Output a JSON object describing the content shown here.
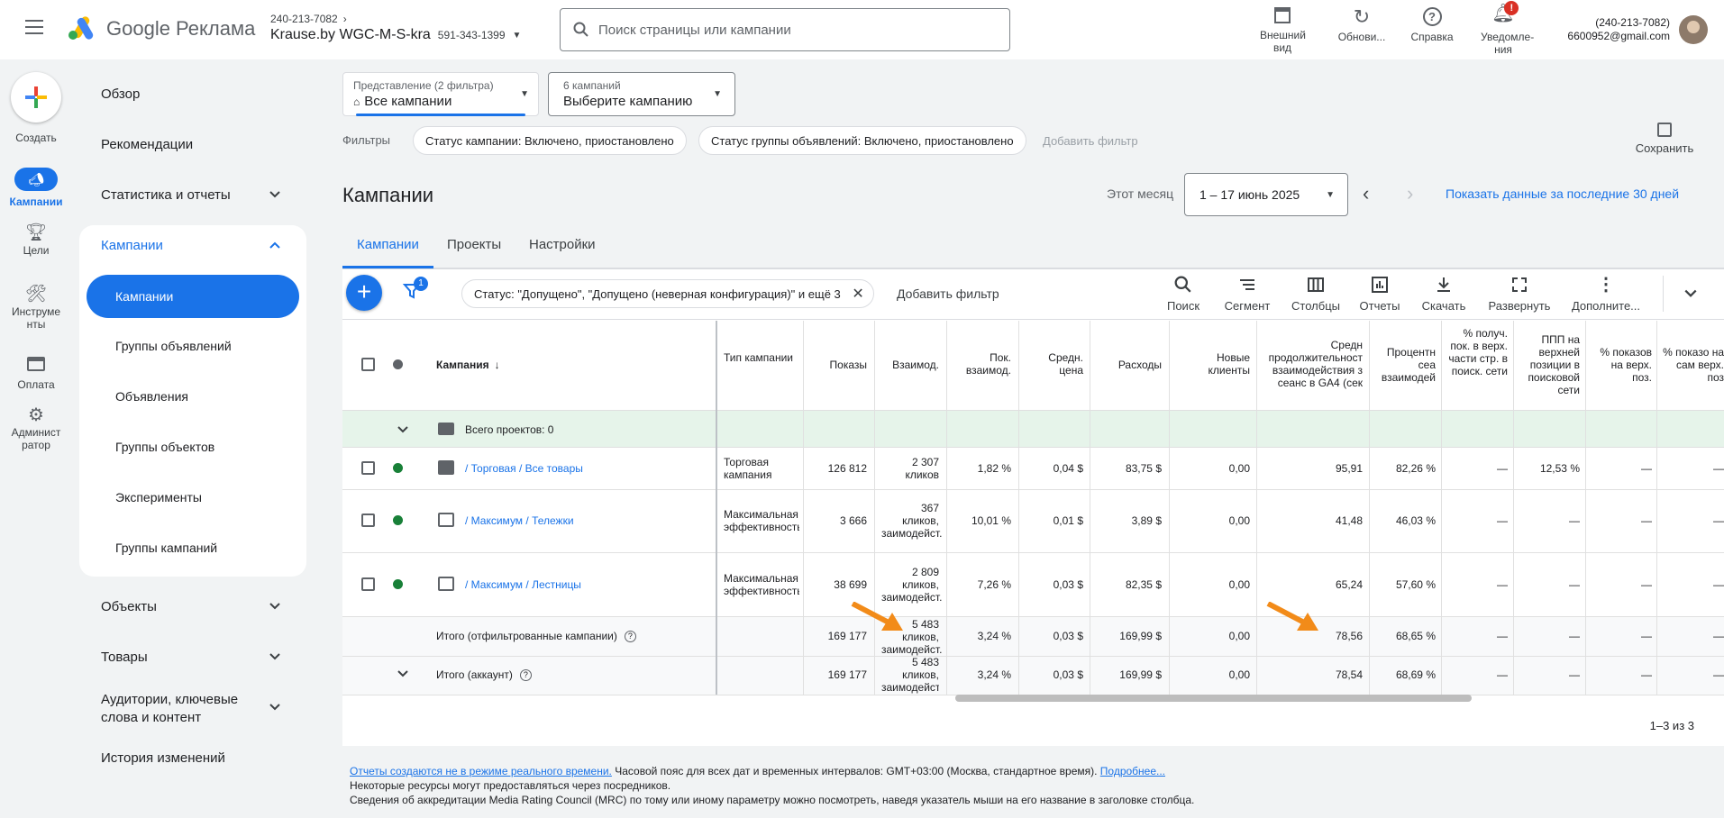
{
  "topbar": {
    "product": "Google Реклама",
    "account_id_top": "240-213-7082",
    "account_name": "Krause.by WGC-M-S-kra",
    "account_id": "591-343-1399",
    "search_placeholder": "Поиск страницы или кампании",
    "actions": [
      {
        "label": "Внешний вид",
        "icon": "appearance-icon"
      },
      {
        "label": "Обнови...",
        "icon": "refresh-icon"
      },
      {
        "label": "Справка",
        "icon": "help-icon"
      },
      {
        "label": "Уведомле-ния",
        "icon": "bell-icon",
        "badge": "!"
      }
    ],
    "user_phone": "(240-213-7082)",
    "user_email": "6600952@gmail.com"
  },
  "rail": {
    "create": "Создать",
    "items": [
      {
        "label": "Кампании",
        "icon": "campaign-icon",
        "active": true
      },
      {
        "label": "Цели",
        "icon": "trophy-icon"
      },
      {
        "label": "Инструме нты",
        "icon": "tools-icon"
      },
      {
        "label": "Оплата",
        "icon": "card-icon"
      },
      {
        "label": "Админист ратор",
        "icon": "gear-icon"
      }
    ]
  },
  "nav": {
    "overview": "Обзор",
    "recommendations": "Рекомендации",
    "stats": "Статистика и отчеты",
    "campaigns": "Кампании",
    "sub": [
      "Кампании",
      "Группы объявлений",
      "Объявления",
      "Группы объектов",
      "Эксперименты",
      "Группы кампаний"
    ],
    "objects": "Объекты",
    "products": "Товары",
    "audiences": "Аудитории, ключевые слова и контент",
    "history": "История изменений"
  },
  "view": {
    "view_label": "Представление (2 фильтра)",
    "view_value": "Все кампании",
    "campaign_label": "6 кампаний",
    "campaign_value": "Выберите кампанию"
  },
  "filters": {
    "label": "Фильтры",
    "chips": [
      "Статус кампании: Включено, приостановлено",
      "Статус группы объявлений: Включено, приостановлено"
    ],
    "add": "Добавить фильтр",
    "save": "Сохранить"
  },
  "page": {
    "title": "Кампании",
    "period_label": "Этот месяц",
    "date_range": "1 – 17 июнь 2025",
    "last30": "Показать данные за последние 30 дней",
    "tabs": [
      "Кампании",
      "Проекты",
      "Настройки"
    ]
  },
  "toolbar": {
    "filter_badge": "1",
    "status_chip": "Статус: \"Допущено\", \"Допущено (неверная конфигурация)\" и ещё 3",
    "add_filter": "Добавить фильтр",
    "tools": [
      "Поиск",
      "Сегмент",
      "Столбцы",
      "Отчеты",
      "Скачать",
      "Развернуть",
      "Дополните..."
    ]
  },
  "table": {
    "headers": {
      "campaign": "Кампания",
      "type": "Тип кампании",
      "impr": "Показы",
      "interactions": "Взаимод.",
      "ir": "Пок. взаимод.",
      "avg": "Средн. цена",
      "cost": "Расходы",
      "new_clients": "Новые клиенты",
      "duration": "Средн продолжительност взаимодействия з сеанс в GA4 (сек",
      "percent": "Процентн сеа взаимодей",
      "top_share": "% получ. пок. в верх. части стр. в поиск. сети",
      "ppp": "ППП на верхней позиции в поисковой сети",
      "top_pct": "% показов на верх. поз.",
      "abs_top": "% показо на сам верх. поз"
    },
    "projects_row": "Всего проектов: 0",
    "rows": [
      {
        "icon": "shopping-tag-icon",
        "name": "/ Торговая / Все товары",
        "type": "Торговая кампания",
        "impr": "126 812",
        "inter": "2 307 кликов",
        "ir": "1,82 %",
        "avg": "0,04 $",
        "cost": "83,75 $",
        "nc": "0,00",
        "dur": "95,91",
        "pct": "82,26 %",
        "ts": "—",
        "ppp": "12,53 %",
        "tp": "—",
        "at": "—"
      },
      {
        "icon": "pmax-icon",
        "name": "/ Максимум / Тележки",
        "type": "Максимальная эффективность",
        "impr": "3 666",
        "inter": "367 кликов, заимодейст.",
        "ir": "10,01 %",
        "avg": "0,01 $",
        "cost": "3,89 $",
        "nc": "0,00",
        "dur": "41,48",
        "pct": "46,03 %",
        "ts": "—",
        "ppp": "—",
        "tp": "—",
        "at": "—"
      },
      {
        "icon": "pmax-icon",
        "name": "/ Максимум / Лестницы",
        "type": "Максимальная эффективность",
        "impr": "38 699",
        "inter": "2 809 кликов, заимодейст.",
        "ir": "7,26 %",
        "avg": "0,03 $",
        "cost": "82,35 $",
        "nc": "0,00",
        "dur": "65,24",
        "pct": "57,60 %",
        "ts": "—",
        "ppp": "—",
        "tp": "—",
        "at": "—"
      }
    ],
    "totals": [
      {
        "name": "Итого (отфильтрованные кампании)",
        "impr": "169 177",
        "inter": "5 483 кликов, заимодейст.",
        "ir": "3,24 %",
        "avg": "0,03 $",
        "cost": "169,99 $",
        "nc": "0,00",
        "dur": "78,56",
        "pct": "68,65 %",
        "ts": "—",
        "ppp": "—",
        "tp": "—",
        "at": "—"
      },
      {
        "name": "Итого (аккаунт)",
        "impr": "169 177",
        "inter": "5 483 кликов, заимодейст.",
        "ir": "3,24 %",
        "avg": "0,03 $",
        "cost": "169,99 $",
        "nc": "0,00",
        "dur": "78,54",
        "pct": "68,69 %",
        "ts": "—",
        "ppp": "—",
        "tp": "—",
        "at": "—"
      }
    ],
    "pagination": "1–3 из 3"
  },
  "footer": {
    "link1": "Отчеты создаются не в режиме реального времени.",
    "text1": " Часовой пояс для всех дат и временных интервалов: GMT+03:00 (Москва, стандартное время). ",
    "link2": "Подробнее...",
    "line2": "Некоторые ресурсы могут предоставляться через посредников.",
    "line3": "Сведения об аккредитации Media Rating Council (MRC) по тому или иному параметру можно посмотреть, наведя указатель мыши на его название в заголовке столбца."
  },
  "colors": {
    "accent": "#1a73e8",
    "active_pill": "#1a73e8",
    "green": "#188038",
    "arrow": "#f28b19",
    "summary_bg": "#e6f4ea"
  }
}
